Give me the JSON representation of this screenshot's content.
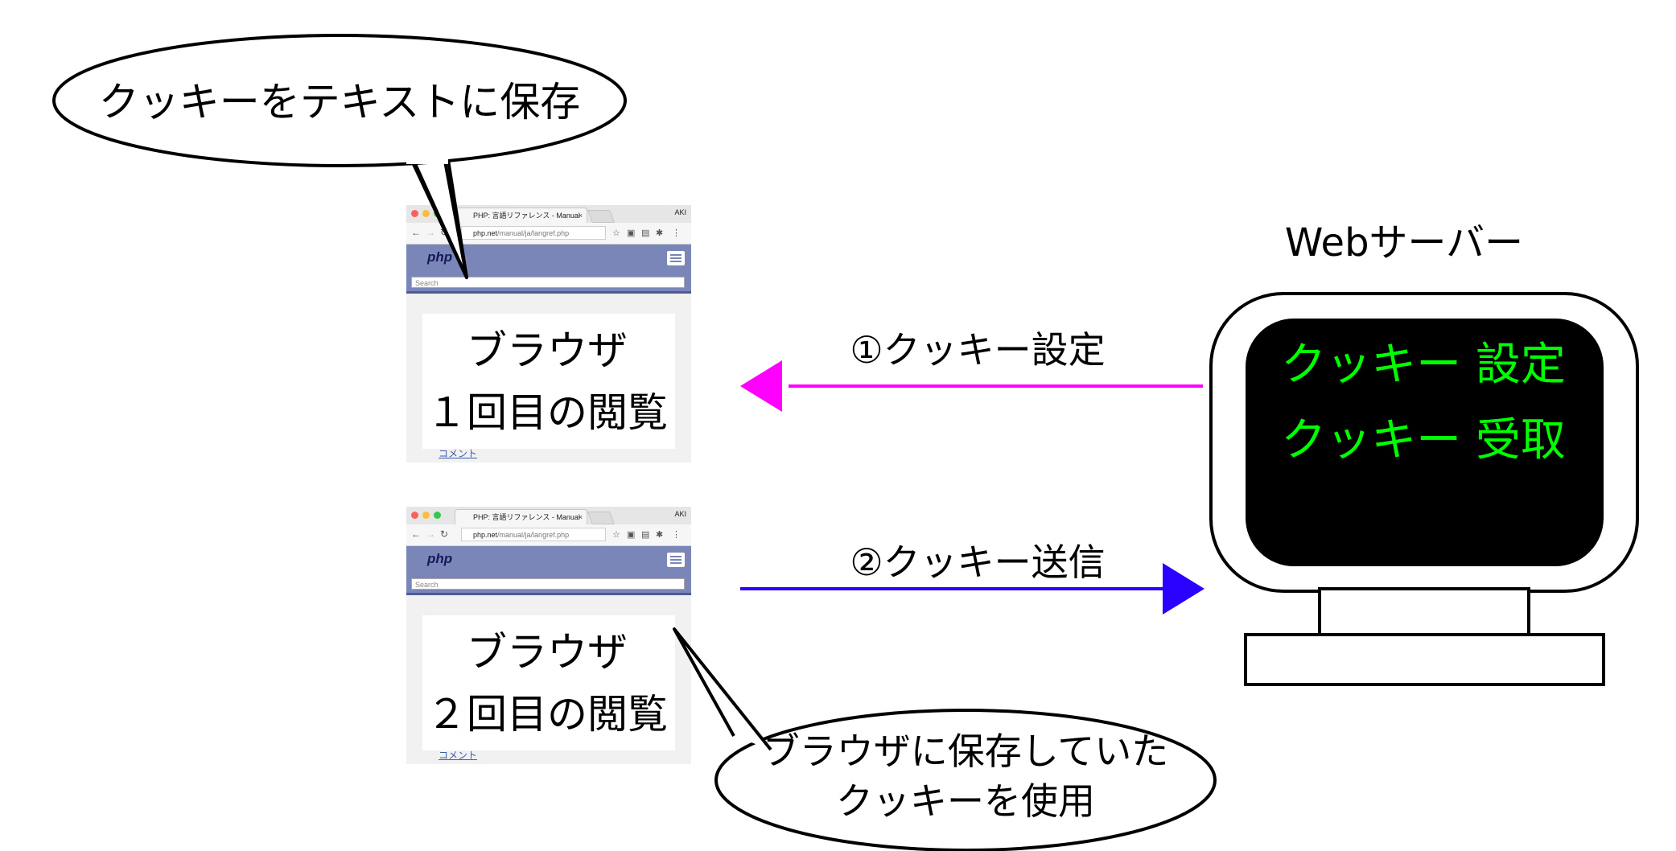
{
  "bubble_top": "クッキーをテキストに保存",
  "bubble_bottom_line1": "ブラウザに保存していた",
  "bubble_bottom_line2": "クッキーを使用",
  "server_label": "Webサーバー",
  "arrow1_label": "①クッキー設定",
  "arrow2_label": "②クッキー送信",
  "screen_line1": "クッキー 設定",
  "screen_line2": "クッキー 受取",
  "browser1": {
    "tab_title": "PHP: 言語リファレンス - Manual",
    "tab_close": "×",
    "user": "AKI",
    "url_host": "php.net",
    "url_path": "/manual/ja/langref.php",
    "logo": "php",
    "search_placeholder": "Search",
    "overlay_line1": "ブラウザ",
    "overlay_line2": "１回目の閲覧",
    "link": "コメント"
  },
  "browser2": {
    "tab_title": "PHP: 言語リファレンス - Manual",
    "tab_close": "×",
    "user": "AKI",
    "url_host": "php.net",
    "url_path": "/manual/ja/langref.php",
    "logo": "php",
    "search_placeholder": "Search",
    "overlay_line1": "ブラウザ",
    "overlay_line2": "２回目の閲覧",
    "link": "コメント"
  },
  "colors": {
    "arrow1": "#ff00ff",
    "arrow2": "#2a00ff",
    "screen_text": "#00ff00",
    "php_header": "#7b86b8"
  }
}
